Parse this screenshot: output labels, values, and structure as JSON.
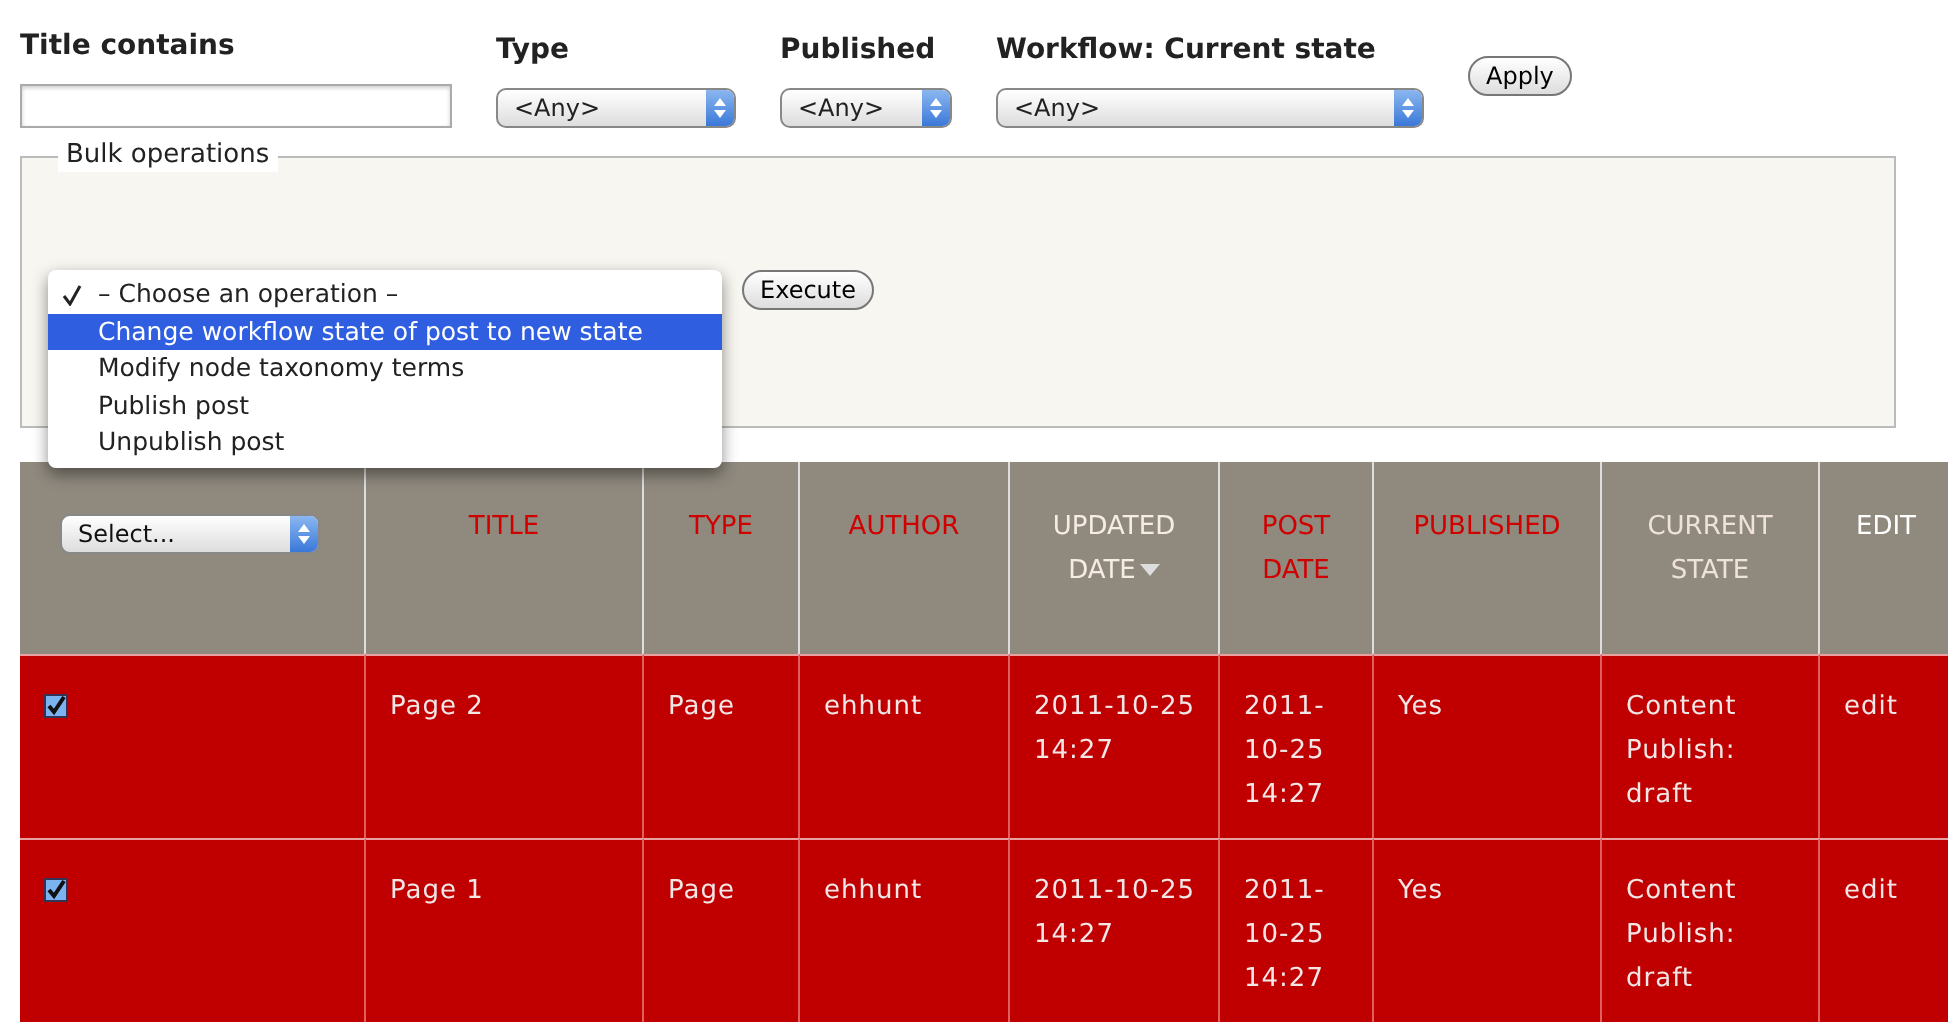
{
  "filters": [
    {
      "label": "Title contains",
      "kind": "text"
    },
    {
      "label": "Type",
      "kind": "select",
      "value": "<Any>"
    },
    {
      "label": "Published",
      "kind": "select",
      "value": "<Any>"
    },
    {
      "label": "Workflow: Current state",
      "kind": "select",
      "value": "<Any>"
    }
  ],
  "apply_button": "Apply",
  "bulk": {
    "legend": "Bulk operations",
    "execute_button": "Execute",
    "options": [
      {
        "label": "– Choose an operation –",
        "checked": true,
        "selected": false
      },
      {
        "label": "Change workflow state of post to new state",
        "checked": false,
        "selected": true
      },
      {
        "label": "Modify node taxonomy terms",
        "checked": false,
        "selected": false
      },
      {
        "label": "Publish post",
        "checked": false,
        "selected": false
      },
      {
        "label": "Unpublish post",
        "checked": false,
        "selected": false
      }
    ]
  },
  "table": {
    "select_control": "Select...",
    "columns": [
      {
        "label": "TITLE",
        "kind": "link"
      },
      {
        "label": "TYPE",
        "kind": "link"
      },
      {
        "label": "AUTHOR",
        "kind": "link"
      },
      {
        "label": "UPDATED DATE",
        "kind": "sorted"
      },
      {
        "label": "POST DATE",
        "kind": "link"
      },
      {
        "label": "PUBLISHED",
        "kind": "link"
      },
      {
        "label": "CURRENT STATE",
        "kind": "muted"
      },
      {
        "label": "EDIT",
        "kind": "plain"
      }
    ],
    "rows": [
      {
        "checked": true,
        "cells": [
          "Page 2",
          "Page",
          "ehhunt",
          "2011-10-25 14:27",
          "2011-10-25 14:27",
          "Yes",
          "Content Publish: draft",
          "edit"
        ]
      },
      {
        "checked": true,
        "cells": [
          "Page 1",
          "Page",
          "ehhunt",
          "2011-10-25 14:27",
          "2011-10-25 14:27",
          "Yes",
          "Content Publish: draft",
          "edit"
        ]
      }
    ]
  }
}
